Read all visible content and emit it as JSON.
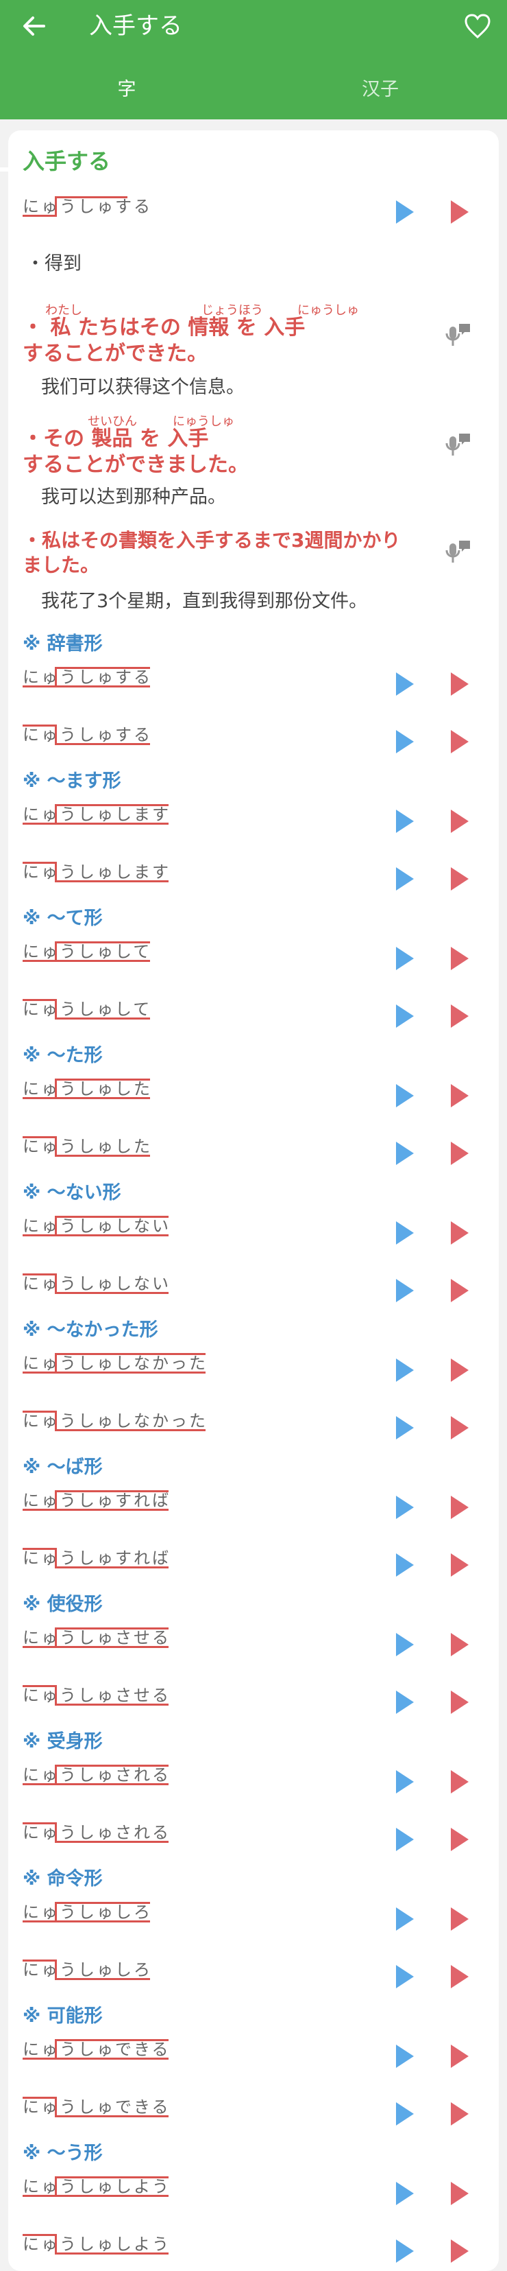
{
  "header": {
    "title": "入手する",
    "tabs": [
      "字",
      "汉子"
    ]
  },
  "word": {
    "title": "入手する",
    "reading": "にゅうしゅする",
    "meaning": "・得到"
  },
  "examples": [
    {
      "jp_line1": "・ 私 たちはその 情報 を 入手",
      "jp_line2": "することができた。",
      "ruby": [
        "わたし",
        "じょうほう",
        "にゅうしゅ"
      ],
      "cn": "我们可以获得这个信息。"
    },
    {
      "jp_line1": "・その 製品 を 入手",
      "jp_line2": "することができました。",
      "ruby": [
        "せいひん",
        "にゅうしゅ"
      ],
      "cn": "我可以达到那种产品。"
    },
    {
      "jp_line1": "・私はその書類を入手するまで3週間かかり",
      "jp_line2": "ました。",
      "ruby": [],
      "cn": "我花了3个星期，直到我得到那份文件。"
    }
  ],
  "forms": [
    {
      "label": "※ 辞書形",
      "a": "にゅうしゅする",
      "b": "にゅうしゅする"
    },
    {
      "label": "※ ～ます形",
      "a": "にゅうしゅします",
      "b": "にゅうしゅします"
    },
    {
      "label": "※ ～て形",
      "a": "にゅうしゅして",
      "b": "にゅうしゅして"
    },
    {
      "label": "※ ～た形",
      "a": "にゅうしゅした",
      "b": "にゅうしゅした"
    },
    {
      "label": "※ ～ない形",
      "a": "にゅうしゅしない",
      "b": "にゅうしゅしない"
    },
    {
      "label": "※ ～なかった形",
      "a": "にゅうしゅしなかった",
      "b": "にゅうしゅしなかった"
    },
    {
      "label": "※ ～ば形",
      "a": "にゅうしゅすれば",
      "b": "にゅうしゅすれば"
    },
    {
      "label": "※ 使役形",
      "a": "にゅうしゅさせる",
      "b": "にゅうしゅさせる"
    },
    {
      "label": "※ 受身形",
      "a": "にゅうしゅされる",
      "b": "にゅうしゅされる"
    },
    {
      "label": "※ 命令形",
      "a": "にゅうしゅしろ",
      "b": "にゅうしゅしろ"
    },
    {
      "label": "※ 可能形",
      "a": "にゅうしゅできる",
      "b": "にゅうしゅできる"
    },
    {
      "label": "※ ～う形",
      "a": "にゅうしゅしよう",
      "b": "にゅうしゅしよう"
    }
  ],
  "colors": {
    "accent_green": "#4caf50",
    "play_blue": "#5ba9e8",
    "play_red": "#e0646b",
    "pitch_line": "#d9534f",
    "section_blue": "#3f8ac8"
  },
  "icons": {
    "back": "back-arrow-icon",
    "favorite": "heart-icon",
    "play_normal": "play-icon",
    "play_alt": "play-icon",
    "speak": "microphone-icon"
  }
}
